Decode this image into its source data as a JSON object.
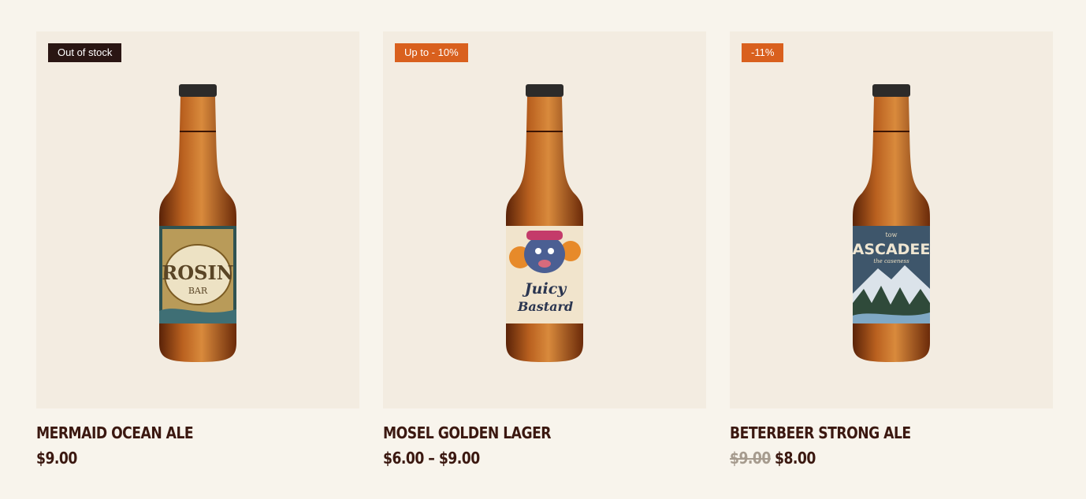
{
  "products": [
    {
      "badge": "Out of stock",
      "badge_color": "#2a1613",
      "label_art": "rosin-bar-label",
      "label_lines": [
        "ROSIN",
        "BAR"
      ],
      "name": "MERMAID OCEAN ALE",
      "price": "$9.00"
    },
    {
      "badge": "Up to - 10%",
      "badge_color": "#d9601e",
      "label_art": "juicy-bastard-label",
      "label_lines": [
        "Juicy",
        "Bastard"
      ],
      "name": "MOSEL GOLDEN LAGER",
      "price": "$6.00 – $9.00"
    },
    {
      "badge": "-11%",
      "badge_color": "#d9601e",
      "label_art": "cascadeed-label",
      "label_lines": [
        "tow",
        "ASCADEE",
        "the caseness"
      ],
      "name": "BETERBEER STRONG ALE",
      "old_price": "$9.00",
      "price": "$8.00"
    }
  ]
}
